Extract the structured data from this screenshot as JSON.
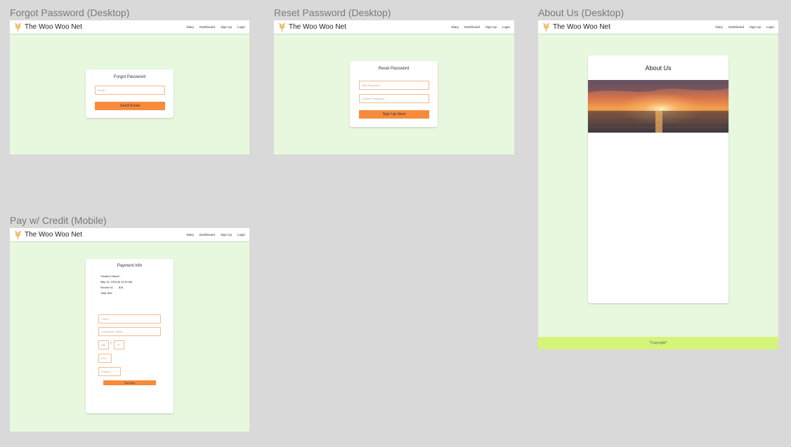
{
  "brand": "The Woo Woo Net",
  "nav": [
    "Diary",
    "Dashboard",
    "Sign Up",
    "Login"
  ],
  "frames": {
    "forgot": {
      "title": "Forgot Password (Desktop)",
      "card_title": "Forgot Password",
      "email_placeholder": "Email *",
      "button": "Send Email"
    },
    "reset": {
      "title": "Reset Password (Desktop)",
      "card_title": "Reset Password",
      "new_password_placeholder": "New Password *",
      "confirm_password_placeholder": "Confirm Password *",
      "button": "Sign Up Here"
    },
    "about": {
      "title": "About Us (Desktop)",
      "card_title": "About Us",
      "footer": "*Copyright*"
    },
    "pay": {
      "title": "Pay w/ Credit (Mobile)",
      "card_title": "Payment Info",
      "healer_name": "*Healer's Name*",
      "datetime": "May 15, 2018 @ 12:30 AM",
      "service_label": "Service #1",
      "service_price": "$15",
      "total": "Total: $15",
      "card_number": "Card #",
      "cardholder": "Cardholder Name",
      "month": "MM",
      "separator": "/",
      "year": "YY",
      "cvv": "CVV",
      "postal": "Postal #",
      "button": "Pay Now"
    }
  },
  "colors": {
    "page_bg": "#d9d9d9",
    "frame_bg": "#e8f8df",
    "accent": "#f68b3c",
    "field_border": "#f5b98a",
    "footer_bg": "#d4f57a"
  }
}
